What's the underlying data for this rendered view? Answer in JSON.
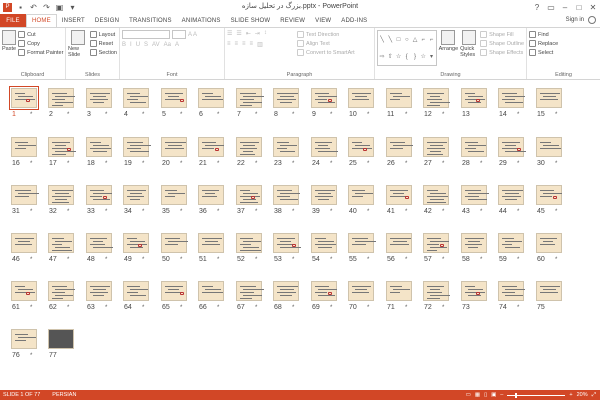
{
  "window": {
    "title": "بزرگ در تحلیل سازه.pptx - PowerPoint",
    "qat_icons": [
      "save-icon",
      "undo-icon",
      "redo-icon",
      "start-slideshow-icon",
      "customize-icon"
    ]
  },
  "tabs": [
    "FILE",
    "HOME",
    "INSERT",
    "DESIGN",
    "TRANSITIONS",
    "ANIMATIONS",
    "SLIDE SHOW",
    "REVIEW",
    "VIEW",
    "ADD-INS"
  ],
  "active_tab": "HOME",
  "account": {
    "signin": "Sign in"
  },
  "ribbon": {
    "clipboard": {
      "label": "Clipboard",
      "paste": "Paste",
      "cut": "Cut",
      "copy": "Copy",
      "format_painter": "Format Painter"
    },
    "slides": {
      "label": "Slides",
      "new_slide": "New Slide",
      "layout": "Layout",
      "reset": "Reset",
      "section": "Section"
    },
    "font": {
      "label": "Font"
    },
    "paragraph": {
      "label": "Paragraph",
      "text_direction": "Text Direction",
      "align_text": "Align Text",
      "convert": "Convert to SmartArt"
    },
    "drawing": {
      "label": "Drawing",
      "arrange": "Arrange",
      "quick_styles": "Quick Styles",
      "shape_fill": "Shape Fill",
      "shape_outline": "Shape Outline",
      "shape_effects": "Shape Effects"
    },
    "editing": {
      "label": "Editing",
      "find": "Find",
      "replace": "Replace",
      "select": "Select"
    }
  },
  "slides": {
    "count": 77,
    "selected": 1,
    "numbers": [
      "1",
      "2",
      "3",
      "4",
      "5",
      "6",
      "7",
      "8",
      "9",
      "10",
      "11",
      "12",
      "13",
      "14",
      "15",
      "16",
      "17",
      "18",
      "19",
      "20",
      "21",
      "22",
      "23",
      "24",
      "25",
      "26",
      "27",
      "28",
      "29",
      "30",
      "31",
      "32",
      "33",
      "34",
      "35",
      "36",
      "37",
      "38",
      "39",
      "40",
      "41",
      "42",
      "43",
      "44",
      "45",
      "46",
      "47",
      "48",
      "49",
      "50",
      "51",
      "52",
      "53",
      "54",
      "55",
      "56",
      "57",
      "58",
      "59",
      "60",
      "61",
      "62",
      "63",
      "64",
      "65",
      "66",
      "67",
      "68",
      "69",
      "70",
      "71",
      "72",
      "73",
      "74",
      "75",
      "76",
      "77"
    ],
    "no_star": [
      "13",
      "73",
      "75",
      "77"
    ],
    "star": "*"
  },
  "status": {
    "slide_info": "SLIDE 1 OF 77",
    "language": "PERSIAN",
    "zoom": "20%"
  },
  "colors": {
    "accent": "#d24726",
    "slide_bg": "#f4e4c8"
  }
}
